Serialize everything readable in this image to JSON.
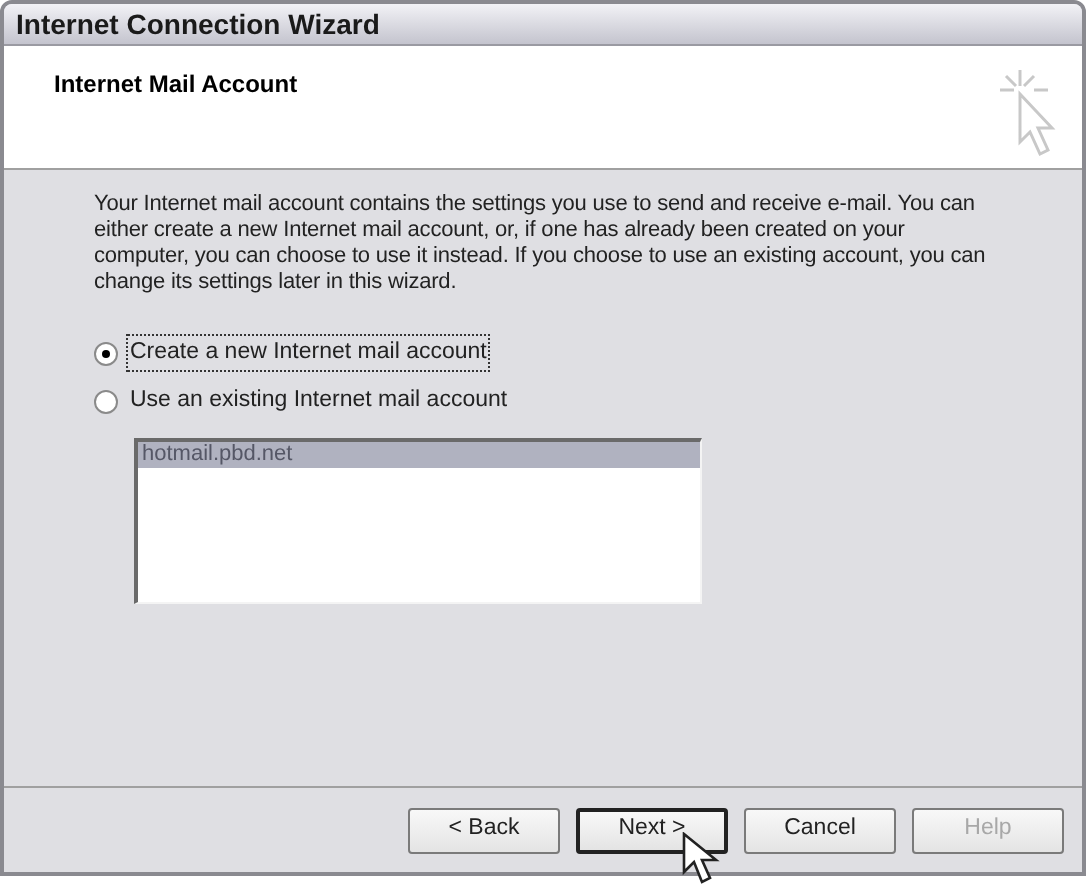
{
  "window": {
    "title": "Internet Connection Wizard"
  },
  "header": {
    "title": "Internet Mail Account"
  },
  "description": "Your Internet mail account contains the settings you use to send and receive e-mail. You can either create a new Internet mail account, or, if one has already been created on your computer, you can choose to use it instead. If you choose to use an existing account, you can change its settings later in this wizard.",
  "options": [
    {
      "label": "Create a new Internet mail account",
      "selected": true
    },
    {
      "label": "Use an existing Internet mail account",
      "selected": false
    }
  ],
  "account_list": {
    "disabled": true,
    "items": [
      {
        "label": "hotmail.pbd.net",
        "selected": true
      }
    ]
  },
  "buttons": [
    {
      "label": "< Back",
      "disabled": false,
      "default": false
    },
    {
      "label": "Next >",
      "disabled": false,
      "default": true
    },
    {
      "label": "Cancel",
      "disabled": false,
      "default": false
    },
    {
      "label": "Help",
      "disabled": true,
      "default": false
    }
  ]
}
